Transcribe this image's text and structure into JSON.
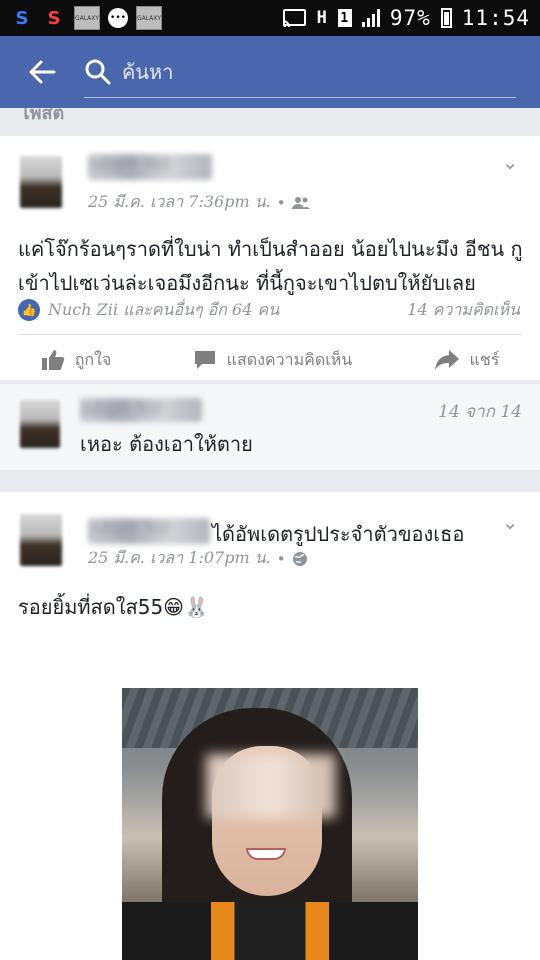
{
  "status_bar": {
    "icons": [
      "s-app-blue",
      "s-app-red",
      "galaxy-rewards-icon",
      "chat-dots-icon",
      "galaxy-rewards-icon"
    ],
    "gallery_label": "GALAXY",
    "network_type": "H",
    "sim_slot": "1",
    "battery": "97%",
    "time": "11:54"
  },
  "app_bar": {
    "search_placeholder": "ค้นหา",
    "color": "#4a67ad"
  },
  "section": {
    "label": "โพสต์"
  },
  "post1": {
    "author": "Jubgm Nid",
    "time": "25 มี.ค. เวลา 7:36pm น.",
    "separator": "•",
    "audience_icon": "friends-icon",
    "text": "แค่โจ๊กร้อนๆราดที่ใบน่า ทำเป็นสำออย น้อยไปนะมึง อีชน กูเข้าไปเซเว่นล่ะเจอมึงอีกนะ ที่นี้กูจะเขาไปตบให้ยับเลย",
    "reactions": "Nuch Zii และคนอื่นๆ อีก 64 คน",
    "comments_count": "14 ความคิดเห็น",
    "actions": {
      "like": "ถูกใจ",
      "comment": "แสดงความคิดเห็น",
      "share": "แชร์"
    }
  },
  "comment": {
    "author": "Jubgm Nid",
    "pager": "14 จาก 14",
    "text": "เหอะ ต้องเอาให้ตาย"
  },
  "post2": {
    "author": "Jubgm Nid",
    "action_text": "ได้อัพเดตรูปประจำตัวของเธอ",
    "time": "25 มี.ค. เวลา 1:07pm น.",
    "separator": "•",
    "audience_icon": "globe-icon",
    "text": "รอยยิ้มที่สดใส55😁🐰"
  },
  "colors": {
    "facebook_blue": "#4267b2",
    "appbar": "#4a67ad",
    "meta_gray": "#90949c",
    "background": "#e9ebee"
  }
}
